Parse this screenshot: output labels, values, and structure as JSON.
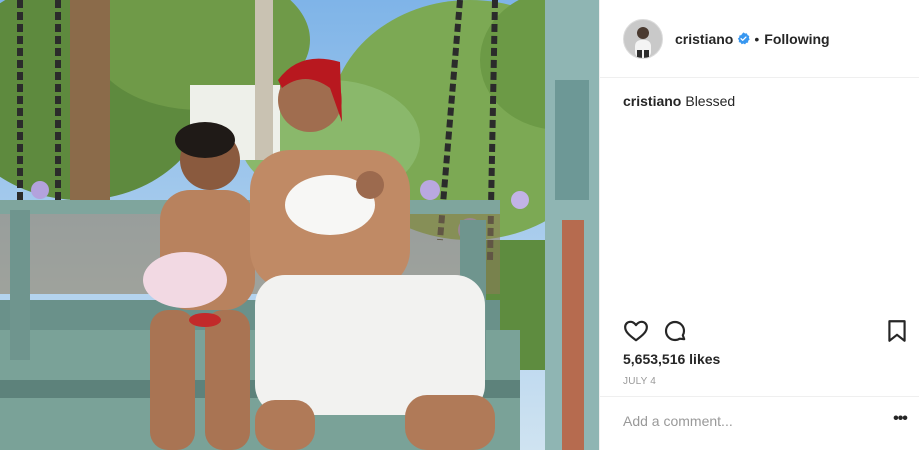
{
  "post": {
    "username": "cristiano",
    "verified": true,
    "separator": "•",
    "follow_status": "Following",
    "caption": {
      "username": "cristiano",
      "text": "Blessed"
    },
    "likes_text": "5,653,516 likes",
    "date": "JULY 4",
    "comment_placeholder": "Add a comment...",
    "more_options": "•••"
  },
  "icons": {
    "like": "heart-icon",
    "comment": "comment-bubble-icon",
    "save": "bookmark-icon",
    "verified": "verified-badge-icon",
    "more": "ellipsis-icon"
  },
  "colors": {
    "text": "#262626",
    "muted": "#999999",
    "border": "#efefef",
    "verified": "#3897f0"
  }
}
